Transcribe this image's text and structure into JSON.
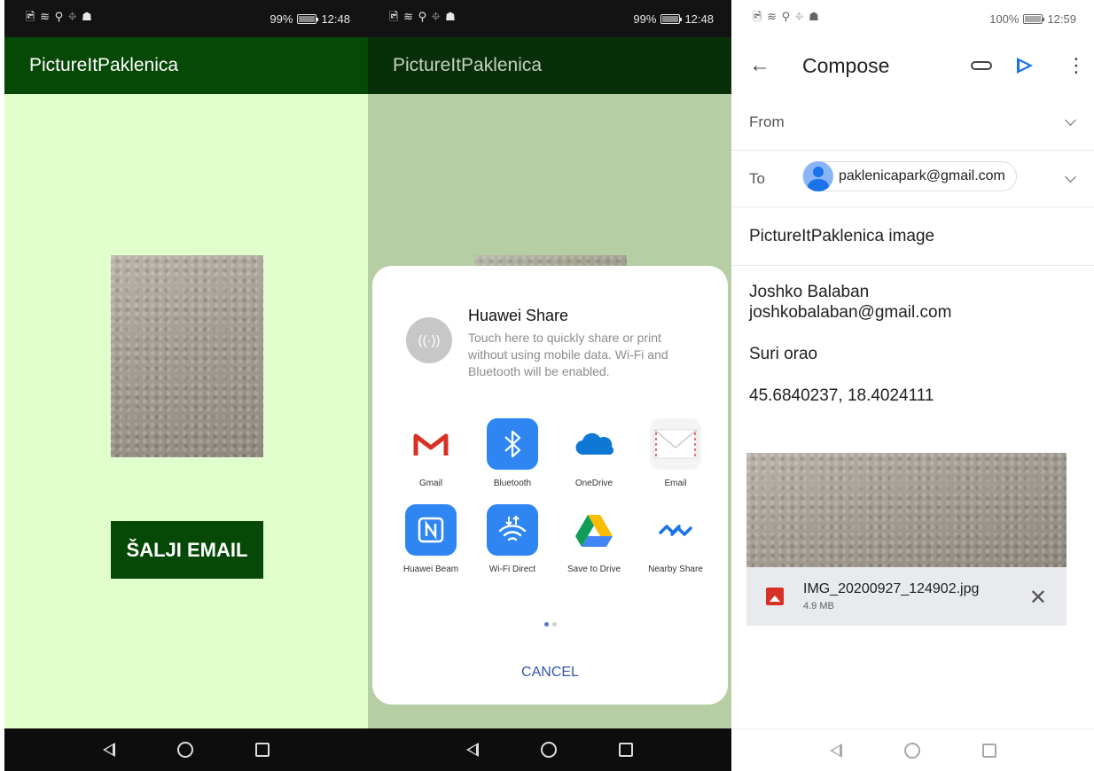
{
  "status": {
    "left_icons": "🖻 ≋ ⚲ ⌖ ☗",
    "p1_battery": "99%",
    "p1_time": "12:48",
    "p2_battery": "99%",
    "p2_time": "12:48",
    "p3_battery": "100%",
    "p3_time": "12:59"
  },
  "app": {
    "title": "PictureItPaklenica",
    "send_email_label": "ŠALJI EMAIL"
  },
  "share_sheet": {
    "huawei_share_title": "Huawei Share",
    "huawei_share_desc": "Touch here to quickly share or print without using mobile data. Wi-Fi and Bluetooth will be enabled.",
    "huawei_share_icon": "((·))",
    "targets": [
      {
        "label": "Gmail",
        "icon": "gmail-icon",
        "color": "#ffffff"
      },
      {
        "label": "Bluetooth",
        "icon": "bluetooth-icon",
        "color": "#2f86f2"
      },
      {
        "label": "OneDrive",
        "icon": "onedrive-icon",
        "color": "#ffffff"
      },
      {
        "label": "Email",
        "icon": "email-icon",
        "color": "#ffffff"
      },
      {
        "label": "Huawei Beam",
        "icon": "nfc-icon",
        "color": "#2f86f2"
      },
      {
        "label": "Wi-Fi Direct",
        "icon": "wifi-direct-icon",
        "color": "#2f86f2"
      },
      {
        "label": "Save to Drive",
        "icon": "drive-icon",
        "color": "#ffffff"
      },
      {
        "label": "Nearby Share",
        "icon": "nearby-share-icon",
        "color": "#ffffff"
      }
    ],
    "cancel_label": "CANCEL"
  },
  "compose": {
    "title": "Compose",
    "from_label": "From",
    "to_label": "To",
    "to_address": "paklenicapark@gmail.com",
    "subject": "PictureItPaklenica image",
    "body_name": "Joshko Balaban",
    "body_email": "joshkobalaban@gmail.com",
    "body_note": "Suri orao",
    "body_coords": "45.6840237, 18.4024111",
    "attachment_name": "IMG_20200927_124902.jpg",
    "attachment_size": "4.9 MB"
  },
  "colors": {
    "app_green": "#064806",
    "app_background": "#e1ffcc",
    "accent_blue": "#1a73e8"
  }
}
